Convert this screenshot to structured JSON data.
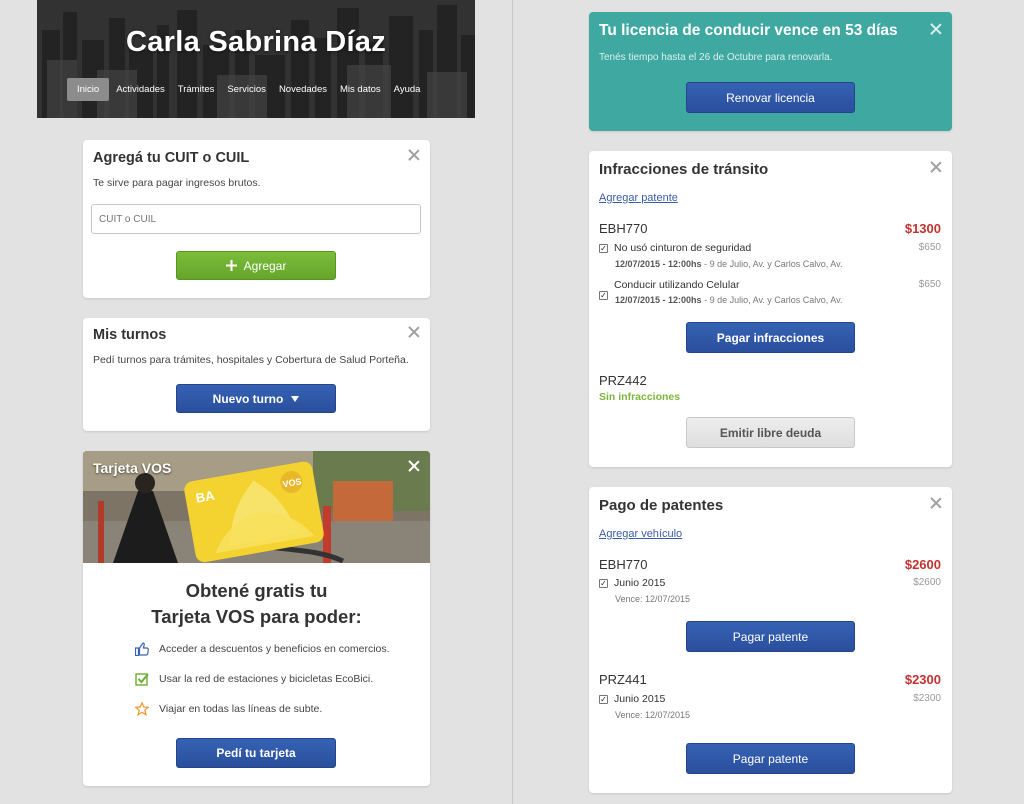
{
  "user": {
    "name": "Carla Sabrina Díaz"
  },
  "nav": {
    "items": [
      "Inicio",
      "Actividades",
      "Trámites",
      "Servicios",
      "Novedades",
      "Mis datos",
      "Ayuda"
    ],
    "active": "Inicio"
  },
  "cuit_card": {
    "title": "Agregá tu CUIT o CUIL",
    "description": "Te sirve para pagar ingresos brutos.",
    "input_placeholder": "CUIT o CUIL",
    "button_label": "Agregar",
    "button_icon": "plus-icon"
  },
  "turnos_card": {
    "title": "Mis turnos",
    "description": "Pedí turnos para trámites, hospitales y Cobertura de Salud Porteña.",
    "button_label": "Nuevo turno",
    "button_icon": "caret-down-icon"
  },
  "vos_card": {
    "title": "Tarjeta VOS",
    "heading_line1": "Obtené gratis tu",
    "heading_line2": "Tarjeta VOS para poder:",
    "benefits": [
      {
        "icon": "thumbs-up-icon",
        "text": "Acceder a descuentos y beneficios en comercios."
      },
      {
        "icon": "checkbox-icon",
        "text": "Usar la red de estaciones y  bicicletas EcoBici."
      },
      {
        "icon": "star-icon",
        "text": "Viajar en todas las líneas de subte."
      }
    ],
    "button_label": "Pedí tu tarjeta",
    "card_logo_left": "BA",
    "card_logo_right": "VOS"
  },
  "license_card": {
    "title": "Tu licencia de conducir vence en 53 días",
    "description": "Tenés tiempo hasta el 26 de Octubre para renovarla.",
    "button_label": "Renovar licencia",
    "bg_color": "#3fa9a1"
  },
  "infractions_card": {
    "title": "Infracciones de tránsito",
    "add_link": "Agregar patente",
    "vehicles": [
      {
        "plate": "EBH770",
        "total": "$1300",
        "items": [
          {
            "label": "No usó cinturon de seguridad",
            "date": "12/07/2015 - 12:00hs",
            "place": " - 9 de Julio, Av. y Carlos Calvo, Av.",
            "amount": "$650",
            "checked": true
          },
          {
            "label": "Conducir utilizando Celular",
            "date": "12/07/2015 - 12:00hs",
            "place": " - 9 de Julio, Av. y Carlos Calvo, Av.",
            "amount": "$650",
            "checked": true
          }
        ],
        "button_label": "Pagar infracciones"
      },
      {
        "plate": "PRZ442",
        "status": "Sin infracciones",
        "button_label": "Emitir libre deuda"
      }
    ],
    "status_green": "#7bb53a",
    "amount_red": "#c4322f"
  },
  "patents_card": {
    "title": "Pago de patentes",
    "add_link": "Agregar vehículo",
    "vehicles": [
      {
        "plate": "EBH770",
        "total": "$2600",
        "item_label": "Junio 2015",
        "item_amount": "$2600",
        "due": "Vence: 12/07/2015",
        "button_label": "Pagar patente",
        "checked": true
      },
      {
        "plate": "PRZ441",
        "total": "$2300",
        "item_label": "Junio 2015",
        "item_amount": "$2300",
        "due": "Vence: 12/07/2015",
        "button_label": "Pagar patente",
        "checked": true
      }
    ]
  },
  "colors": {
    "primary_blue": "#2f58a8",
    "green": "#72b133",
    "page_bg": "#e2e2e2"
  }
}
